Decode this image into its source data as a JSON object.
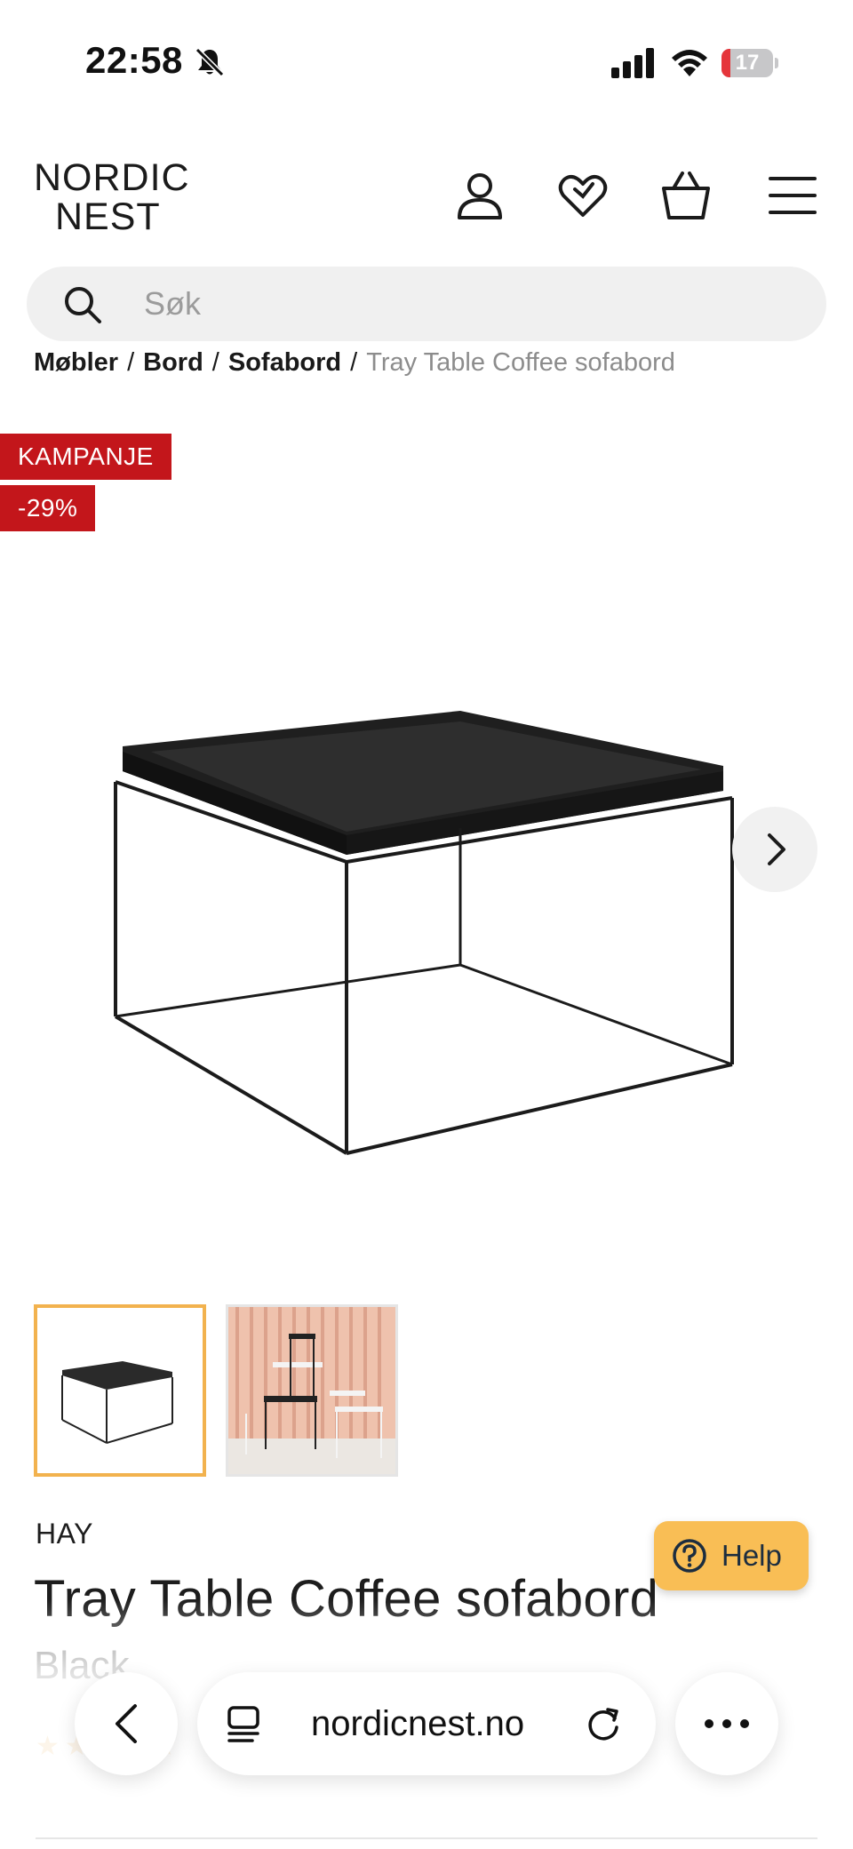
{
  "status_bar": {
    "time": "22:58",
    "battery_level": "17",
    "battery_fraction": 0.17,
    "icons": [
      "bell-slash-icon",
      "signal-icon",
      "wifi-icon",
      "battery-icon"
    ]
  },
  "header": {
    "logo_line1": "NORDIC",
    "logo_line2": "NEST",
    "icons": [
      "user-icon",
      "heart-icon",
      "basket-icon",
      "menu-icon"
    ]
  },
  "search": {
    "placeholder": "Søk"
  },
  "breadcrumb": {
    "items": [
      "Møbler",
      "Bord",
      "Sofabord"
    ],
    "current": "Tray Table Coffee sofabord",
    "separator": "/"
  },
  "badges": {
    "campaign": "KAMPANJE",
    "discount": "-29%"
  },
  "gallery": {
    "image_count": 2,
    "selected_index": 0
  },
  "product": {
    "brand": "HAY",
    "title": "Tray Table Coffee sofabord",
    "variant": "Black",
    "rating_stars": "★★★★★"
  },
  "help": {
    "label": "Help"
  },
  "browser": {
    "url": "nordicnest.no"
  },
  "colors": {
    "badge_red": "#c3161b",
    "help_yellow": "#f9be55",
    "thumb_selected_border": "#f2b24e",
    "battery_red": "#e5353b"
  }
}
